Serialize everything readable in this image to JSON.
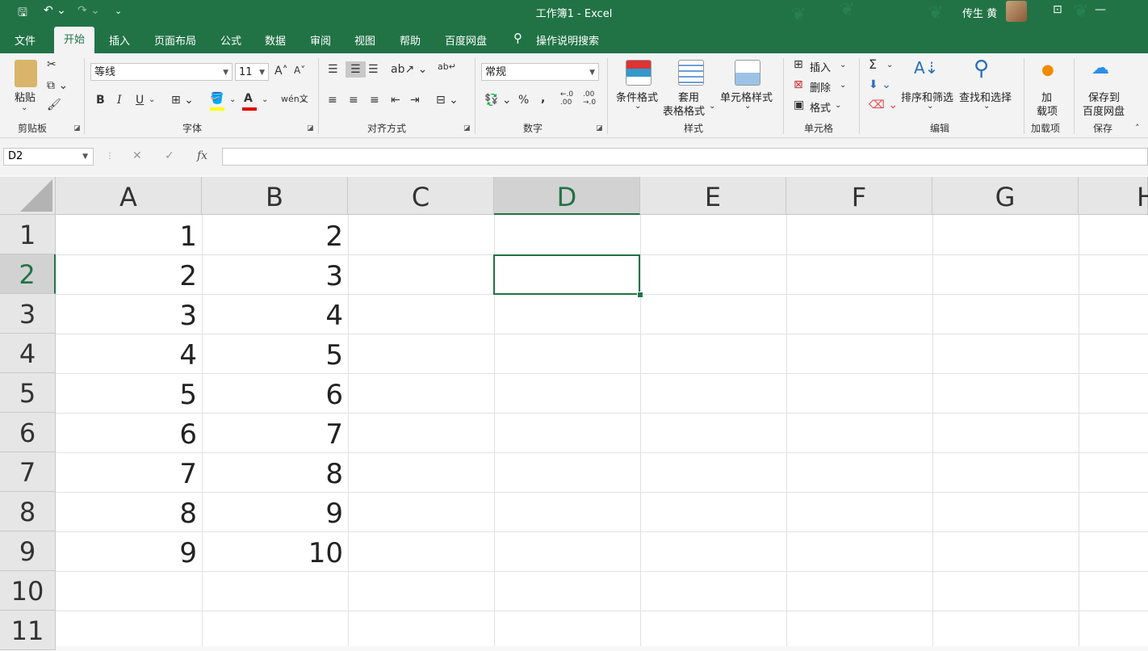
{
  "titlebar": {
    "title": "工作簿1  -  Excel",
    "user": "传生 黄",
    "save_icon": "save-icon",
    "undo_icon": "undo-icon",
    "redo_icon": "redo-icon",
    "customize_icon": "customize-icon"
  },
  "tabs": [
    "文件",
    "开始",
    "插入",
    "页面布局",
    "公式",
    "数据",
    "审阅",
    "视图",
    "帮助",
    "百度网盘"
  ],
  "active_tab": "开始",
  "tell_me": "操作说明搜索",
  "ribbon": {
    "clipboard": {
      "paste": "粘贴",
      "label": "剪贴板"
    },
    "font": {
      "name": "等线",
      "size": "11",
      "label": "字体",
      "bold": "B",
      "italic": "I",
      "underline": "U",
      "font_color": "A",
      "phonetic": "wén文"
    },
    "alignment": {
      "label": "对齐方式"
    },
    "number": {
      "format": "常规",
      "label": "数字",
      "percent": "%",
      "comma": ",",
      "inc_decimal": "←.0 .00",
      "dec_decimal": ".00 →.0"
    },
    "styles": {
      "conditional": "条件格式",
      "table_1": "套用",
      "table_2": "表格格式",
      "cell_styles": "单元格样式",
      "label": "样式"
    },
    "cells": {
      "insert": "插入",
      "delete": "删除",
      "format": "格式",
      "label": "单元格"
    },
    "editing": {
      "sum": "Σ",
      "sort": "排序和筛选",
      "find": "查找和选择",
      "label": "编辑"
    },
    "addins": {
      "add_1": "加",
      "add_2": "载项",
      "label": "加载项"
    },
    "save": {
      "save_1": "保存到",
      "save_2": "百度网盘",
      "label": "保存"
    }
  },
  "formula_bar": {
    "name_box": "D2",
    "cancel": "✕",
    "enter": "✓",
    "fx": "fx",
    "content": ""
  },
  "sheet": {
    "columns": [
      "A",
      "B",
      "C",
      "D",
      "E",
      "F",
      "G",
      "H"
    ],
    "rows": [
      "1",
      "2",
      "3",
      "4",
      "5",
      "6",
      "7",
      "8",
      "9",
      "10",
      "11"
    ],
    "selected_column": "D",
    "selected_row": "2",
    "colA": [
      "1",
      "2",
      "3",
      "4",
      "5",
      "6",
      "7",
      "8",
      "9"
    ],
    "colB": [
      "2",
      "3",
      "4",
      "5",
      "6",
      "7",
      "8",
      "9",
      "10"
    ]
  },
  "colors": {
    "accent": "#217346",
    "header_bg": "#e6e6e6",
    "selected_header": "#d2d2d2"
  }
}
